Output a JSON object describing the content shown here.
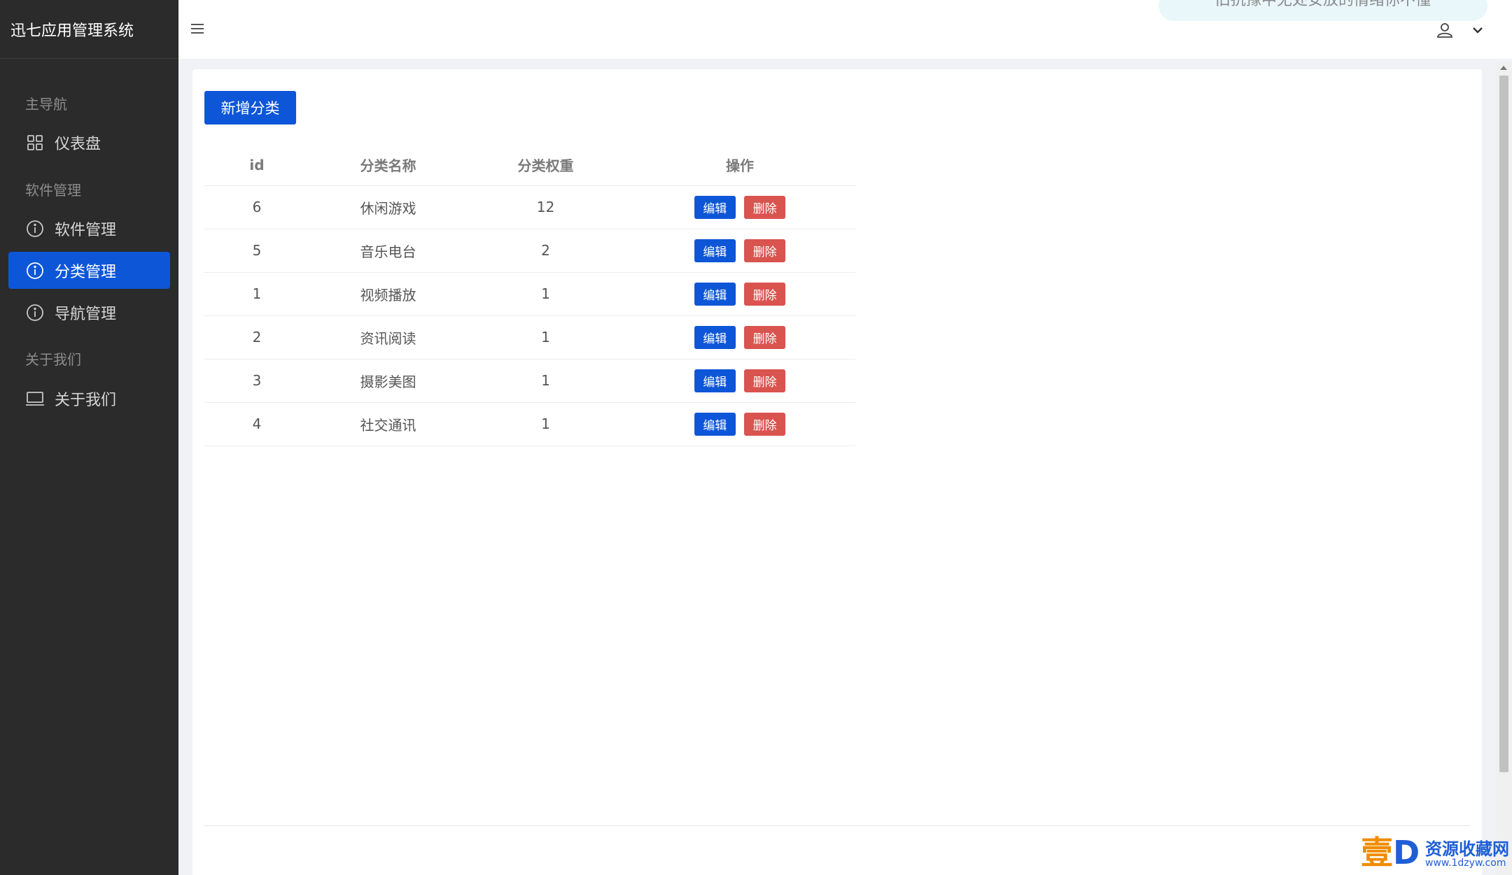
{
  "app": {
    "title": "迅七应用管理系统"
  },
  "sidebar": {
    "groups": [
      {
        "title": "主导航"
      },
      {
        "title": "软件管理"
      },
      {
        "title": "关于我们"
      }
    ],
    "items": [
      {
        "label": "仪表盘",
        "icon": "grid-icon"
      },
      {
        "label": "软件管理",
        "icon": "info-circle-icon"
      },
      {
        "label": "分类管理",
        "icon": "info-circle-icon",
        "active": true
      },
      {
        "label": "导航管理",
        "icon": "info-circle-icon"
      },
      {
        "label": "关于我们",
        "icon": "laptop-icon"
      }
    ]
  },
  "header": {
    "marquee": "旧抗豫中无处安放的情绪你不懂"
  },
  "main": {
    "add_button": "新增分类",
    "table": {
      "headers": [
        "id",
        "分类名称",
        "分类权重",
        "操作"
      ],
      "rows": [
        {
          "id": "6",
          "name": "休闲游戏",
          "weight": "12"
        },
        {
          "id": "5",
          "name": "音乐电台",
          "weight": "2"
        },
        {
          "id": "1",
          "name": "视频播放",
          "weight": "1"
        },
        {
          "id": "2",
          "name": "资讯阅读",
          "weight": "1"
        },
        {
          "id": "3",
          "name": "摄影美图",
          "weight": "1"
        },
        {
          "id": "4",
          "name": "社交通讯",
          "weight": "1"
        }
      ],
      "edit_label": "编辑",
      "delete_label": "删除"
    }
  },
  "watermark": {
    "logo_left": "壹",
    "logo_right": "D",
    "text": "资源收藏网",
    "url": "www.1dzyw.com"
  },
  "colors": {
    "primary": "#0d56d8",
    "danger": "#d9534f",
    "sidebar_bg": "#2b2b2b"
  }
}
